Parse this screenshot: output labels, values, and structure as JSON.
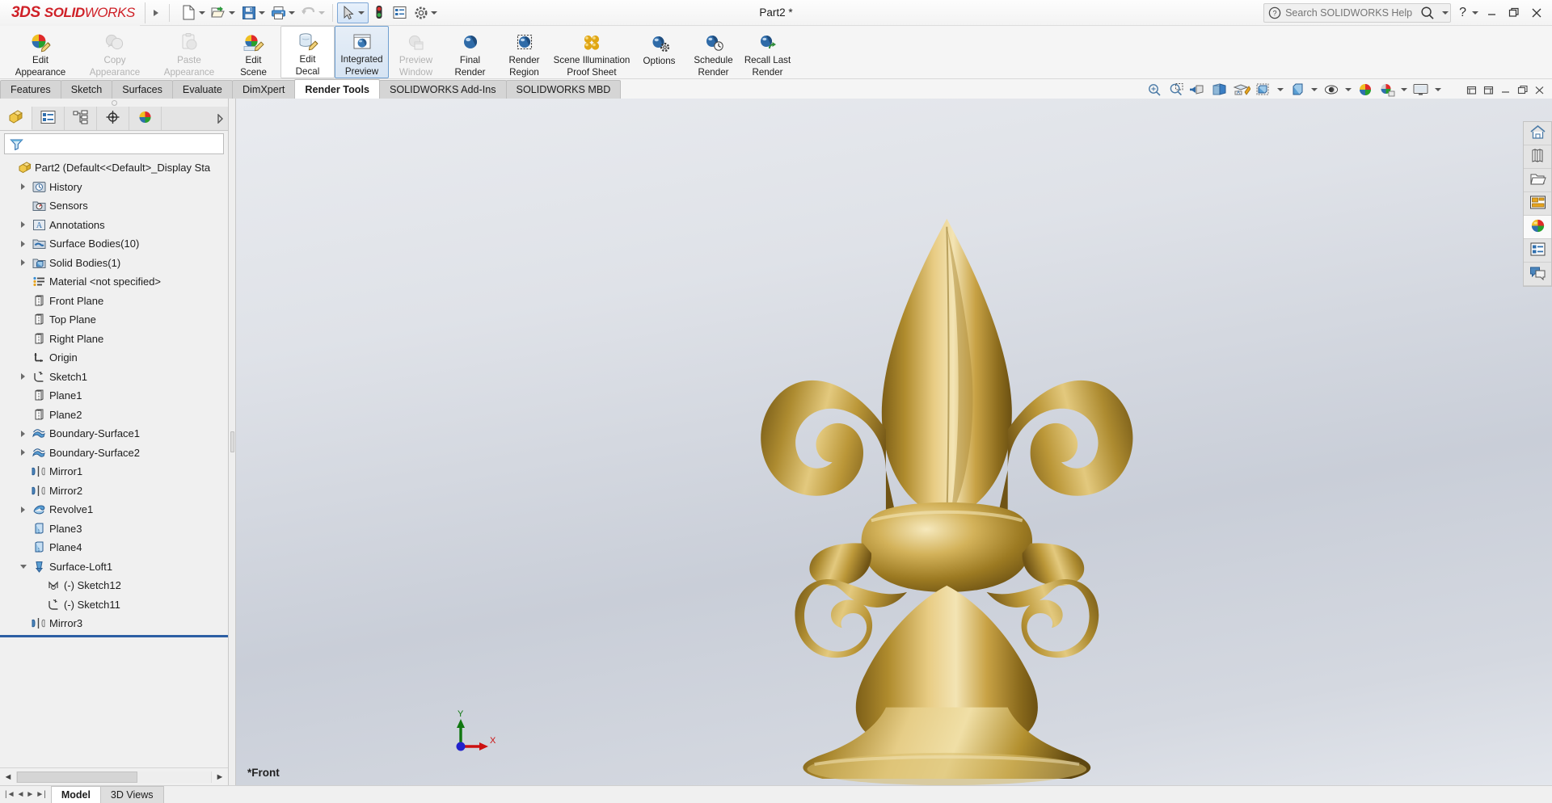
{
  "titlebar": {
    "brand_ds": "3DS",
    "brand_bold": "SOLID",
    "brand_light": "WORKS",
    "document_title": "Part2 *",
    "quick_access": [
      {
        "name": "new-document",
        "icon": "new-doc-icon",
        "has_dropdown": true
      },
      {
        "name": "open-document",
        "icon": "open-folder-icon",
        "has_dropdown": true
      },
      {
        "name": "save-document",
        "icon": "save-disk-icon",
        "has_dropdown": true
      },
      {
        "name": "print-document",
        "icon": "printer-icon",
        "has_dropdown": true
      },
      {
        "name": "undo",
        "icon": "undo-arrow-icon",
        "has_dropdown": true,
        "disabled": true
      },
      {
        "name": "select",
        "icon": "cursor-arrow-icon",
        "has_dropdown": true,
        "selected": true
      },
      {
        "name": "rebuild",
        "icon": "traffic-light-icon",
        "has_dropdown": false
      },
      {
        "name": "options-list",
        "icon": "list-panel-icon",
        "has_dropdown": false
      },
      {
        "name": "settings",
        "icon": "gear-icon",
        "has_dropdown": true
      }
    ],
    "search": {
      "placeholder": "Search SOLIDWORKS Help",
      "value": "",
      "help_icon": "question-circle-icon",
      "magnifier_icon": "magnifier-icon"
    },
    "help_label": "?",
    "window_buttons": {
      "minimize": "–",
      "restore": "❐",
      "close": "✕"
    }
  },
  "ribbon": {
    "items": [
      {
        "label_line1": "Edit",
        "label_line2": "Appearance",
        "icon": "appearance-sphere-pencil-icon",
        "state": "normal",
        "width": "wide"
      },
      {
        "label_line1": "Copy",
        "label_line2": "Appearance",
        "icon": "copy-appearance-icon",
        "state": "disabled",
        "width": "wide"
      },
      {
        "label_line1": "Paste",
        "label_line2": "Appearance",
        "icon": "paste-appearance-icon",
        "state": "disabled",
        "width": "wide"
      },
      {
        "label_line1": "Edit",
        "label_line2": "Scene",
        "icon": "scene-sphere-pencil-icon",
        "state": "normal",
        "width": "normal"
      },
      {
        "label_line1": "Edit",
        "label_line2": "Decal",
        "icon": "decal-can-pencil-icon",
        "state": "boxed",
        "width": "normal"
      },
      {
        "label_line1": "Integrated",
        "label_line2": "Preview",
        "icon": "integrated-preview-icon",
        "state": "active",
        "width": "normal"
      },
      {
        "label_line1": "Preview",
        "label_line2": "Window",
        "icon": "preview-window-icon",
        "state": "disabled",
        "width": "normal"
      },
      {
        "label_line1": "Final",
        "label_line2": "Render",
        "icon": "final-render-sphere-icon",
        "state": "normal",
        "width": "normal"
      },
      {
        "label_line1": "Render",
        "label_line2": "Region",
        "icon": "render-region-icon",
        "state": "normal",
        "width": "normal"
      },
      {
        "label_line1": "Scene Illumination",
        "label_line2": "Proof Sheet",
        "icon": "scene-illumination-icon",
        "state": "normal",
        "width": "xwide"
      },
      {
        "label_line1": "Options",
        "label_line2": "",
        "icon": "options-sphere-gear-icon",
        "state": "normal",
        "width": "normal"
      },
      {
        "label_line1": "Schedule",
        "label_line2": "Render",
        "icon": "schedule-render-icon",
        "state": "normal",
        "width": "normal"
      },
      {
        "label_line1": "Recall Last",
        "label_line2": "Render",
        "icon": "recall-last-render-icon",
        "state": "normal",
        "width": "normal"
      }
    ]
  },
  "command_tabs": [
    {
      "label": "Features",
      "active": false
    },
    {
      "label": "Sketch",
      "active": false
    },
    {
      "label": "Surfaces",
      "active": false
    },
    {
      "label": "Evaluate",
      "active": false
    },
    {
      "label": "DimXpert",
      "active": false
    },
    {
      "label": "Render Tools",
      "active": true
    },
    {
      "label": "SOLIDWORKS Add-Ins",
      "active": false
    },
    {
      "label": "SOLIDWORKS MBD",
      "active": false
    }
  ],
  "view_toolbar": [
    {
      "name": "zoom-to-fit",
      "icon": "zoom-fit-icon",
      "dropdown": false
    },
    {
      "name": "zoom-to-area",
      "icon": "zoom-area-icon",
      "dropdown": false
    },
    {
      "name": "previous-view",
      "icon": "previous-view-icon",
      "dropdown": false
    },
    {
      "name": "section-view",
      "icon": "section-view-icon",
      "dropdown": false
    },
    {
      "name": "view-orientation",
      "icon": "view-orientation-icon",
      "dropdown": false
    },
    {
      "name": "display-style",
      "icon": "display-style-cube-icon",
      "dropdown": true
    },
    {
      "name": "hide-show-items",
      "icon": "hide-show-cube-icon",
      "dropdown": true
    },
    {
      "name": "edit-appearance",
      "icon": "appearance-eye-icon",
      "dropdown": true
    },
    {
      "name": "apply-scene",
      "icon": "apply-scene-sphere-icon",
      "dropdown": false
    },
    {
      "name": "view-settings",
      "icon": "view-settings-icon",
      "dropdown": true
    },
    {
      "name": "viewport-layout",
      "icon": "viewport-monitor-icon",
      "dropdown": true
    }
  ],
  "window_controls_right": [
    "restore-down-icon",
    "panel-icon",
    "maximize-icon",
    "close-icon"
  ],
  "feature_manager": {
    "tabs": [
      {
        "name": "feature-manager-design-tree",
        "icon": "yellow-part-icon",
        "selected": true
      },
      {
        "name": "property-manager",
        "icon": "property-list-icon",
        "selected": false
      },
      {
        "name": "configuration-manager",
        "icon": "configuration-icon",
        "selected": false
      },
      {
        "name": "dimxpert-manager",
        "icon": "dimxpert-target-icon",
        "selected": false
      },
      {
        "name": "display-manager",
        "icon": "display-manager-sphere-icon",
        "selected": false
      }
    ],
    "filter": {
      "placeholder": "",
      "value": "",
      "icon": "filter-funnel-icon"
    },
    "tree": [
      {
        "label": "Part2  (Default<<Default>_Display Sta",
        "icon": "part-root-icon",
        "indent": 0,
        "expander": "none"
      },
      {
        "label": "History",
        "icon": "history-icon",
        "indent": 1,
        "expander": "collapsed"
      },
      {
        "label": "Sensors",
        "icon": "sensors-icon",
        "indent": 1,
        "expander": "none"
      },
      {
        "label": "Annotations",
        "icon": "annotations-icon",
        "indent": 1,
        "expander": "collapsed"
      },
      {
        "label": "Surface Bodies(10)",
        "icon": "surface-bodies-icon",
        "indent": 1,
        "expander": "collapsed"
      },
      {
        "label": "Solid Bodies(1)",
        "icon": "solid-bodies-icon",
        "indent": 1,
        "expander": "collapsed"
      },
      {
        "label": "Material <not specified>",
        "icon": "material-icon",
        "indent": 1,
        "expander": "none"
      },
      {
        "label": "Front Plane",
        "icon": "plane-icon",
        "indent": 1,
        "expander": "none"
      },
      {
        "label": "Top Plane",
        "icon": "plane-icon",
        "indent": 1,
        "expander": "none"
      },
      {
        "label": "Right Plane",
        "icon": "plane-icon",
        "indent": 1,
        "expander": "none"
      },
      {
        "label": "Origin",
        "icon": "origin-icon",
        "indent": 1,
        "expander": "none"
      },
      {
        "label": "Sketch1",
        "icon": "sketch-icon",
        "indent": 1,
        "expander": "collapsed"
      },
      {
        "label": "Plane1",
        "icon": "plane-icon",
        "indent": 1,
        "expander": "none"
      },
      {
        "label": "Plane2",
        "icon": "plane-icon",
        "indent": 1,
        "expander": "none"
      },
      {
        "label": "Boundary-Surface1",
        "icon": "boundary-surface-icon",
        "indent": 1,
        "expander": "collapsed"
      },
      {
        "label": "Boundary-Surface2",
        "icon": "boundary-surface-icon",
        "indent": 1,
        "expander": "collapsed"
      },
      {
        "label": "Mirror1",
        "icon": "mirror-icon",
        "indent": 1,
        "expander": "none"
      },
      {
        "label": "Mirror2",
        "icon": "mirror-icon",
        "indent": 1,
        "expander": "none"
      },
      {
        "label": "Revolve1",
        "icon": "revolve-icon",
        "indent": 1,
        "expander": "collapsed"
      },
      {
        "label": "Plane3",
        "icon": "plane-blue-icon",
        "indent": 1,
        "expander": "none"
      },
      {
        "label": "Plane4",
        "icon": "plane-blue-icon",
        "indent": 1,
        "expander": "none"
      },
      {
        "label": "Surface-Loft1",
        "icon": "surface-loft-icon",
        "indent": 1,
        "expander": "expanded"
      },
      {
        "label": "(-) Sketch12",
        "icon": "sketch-spline-icon",
        "indent": 2,
        "expander": "none"
      },
      {
        "label": "(-) Sketch11",
        "icon": "sketch-icon",
        "indent": 2,
        "expander": "none"
      },
      {
        "label": "Mirror3",
        "icon": "mirror-icon",
        "indent": 1,
        "expander": "none"
      }
    ]
  },
  "viewport": {
    "view_label": "*Front",
    "triad": {
      "x_label": "X",
      "y_label": "Y",
      "x_color": "#cc1111",
      "y_color": "#117711",
      "origin_color": "#1111cc"
    },
    "model_colors": {
      "gold_light": "#e6c272",
      "gold_mid": "#bd9239",
      "gold_dark": "#7a5c16",
      "gold_highlight": "#f5e3b0"
    },
    "background_colors": {
      "top": "#e9ebef",
      "mid": "#c9ced8",
      "bottom": "#e3e6ec"
    }
  },
  "task_pane": [
    {
      "name": "sw-resources",
      "icon": "home-icon",
      "selected": false
    },
    {
      "name": "design-library",
      "icon": "library-books-icon",
      "selected": false
    },
    {
      "name": "file-explorer",
      "icon": "folder-icon",
      "selected": false
    },
    {
      "name": "view-palette",
      "icon": "view-palette-icon",
      "selected": false
    },
    {
      "name": "appearances-scenes-decals",
      "icon": "appearances-sphere-icon",
      "selected": true
    },
    {
      "name": "custom-properties",
      "icon": "custom-properties-icon",
      "selected": false
    },
    {
      "name": "solidworks-forum",
      "icon": "forum-chat-icon",
      "selected": false
    }
  ],
  "statusbar": {
    "tabs": [
      {
        "label": "Model",
        "active": true
      },
      {
        "label": "3D Views",
        "active": false
      }
    ]
  }
}
